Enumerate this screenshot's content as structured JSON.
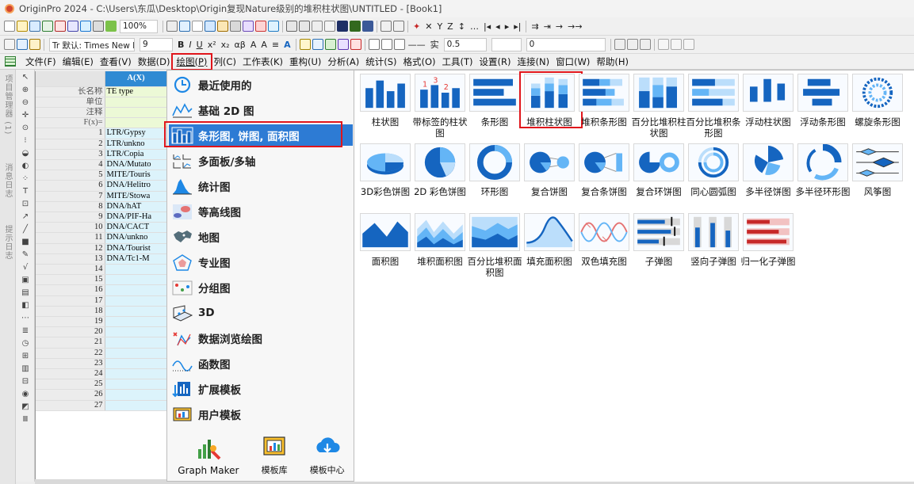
{
  "window": {
    "title": "OriginPro 2024 - C:\\Users\\东瓜\\Desktop\\Origin复现Nature级别的堆积柱状图\\UNTITLED - [Book1]"
  },
  "toolbar1": {
    "zoom": "100%"
  },
  "toolbar2": {
    "font_name": "Tr 默认: Times New R",
    "font_size": "9",
    "line_style": "实",
    "line_width": "0.5",
    "pattern_value": "0"
  },
  "menubar": {
    "items": [
      "文件(F)",
      "编辑(E)",
      "查看(V)",
      "数据(D)",
      "绘图(P)",
      "列(C)",
      "工作表(K)",
      "重构(U)",
      "分析(A)",
      "统计(S)",
      "格式(O)",
      "工具(T)",
      "设置(R)",
      "连接(N)",
      "窗口(W)",
      "帮助(H)"
    ],
    "active": "绘图(P)"
  },
  "sidebar": {
    "tabs": [
      "项目管理器 (1)",
      "消息日志",
      "提示日志"
    ]
  },
  "sheet": {
    "column_header": "A(X)",
    "meta_rows": [
      {
        "label": "长名称",
        "value": "TE type"
      },
      {
        "label": "单位",
        "value": ""
      },
      {
        "label": "注释",
        "value": ""
      },
      {
        "label": "F(x)=",
        "value": ""
      }
    ],
    "rows": [
      {
        "n": "1",
        "v": "LTR/Gypsy"
      },
      {
        "n": "2",
        "v": "LTR/unkno"
      },
      {
        "n": "3",
        "v": "LTR/Copia"
      },
      {
        "n": "4",
        "v": "DNA/Mutato"
      },
      {
        "n": "5",
        "v": "MITE/Touris"
      },
      {
        "n": "6",
        "v": "DNA/Helitro"
      },
      {
        "n": "7",
        "v": "MITE/Stowa"
      },
      {
        "n": "8",
        "v": "DNA/hAT"
      },
      {
        "n": "9",
        "v": "DNA/PIF-Ha"
      },
      {
        "n": "10",
        "v": "DNA/CACT"
      },
      {
        "n": "11",
        "v": "DNA/unkno"
      },
      {
        "n": "12",
        "v": "DNA/Tourist"
      },
      {
        "n": "13",
        "v": "DNA/Tc1-M"
      },
      {
        "n": "14",
        "v": ""
      },
      {
        "n": "15",
        "v": ""
      },
      {
        "n": "16",
        "v": ""
      },
      {
        "n": "17",
        "v": ""
      },
      {
        "n": "18",
        "v": ""
      },
      {
        "n": "19",
        "v": ""
      },
      {
        "n": "20",
        "v": ""
      },
      {
        "n": "21",
        "v": ""
      },
      {
        "n": "22",
        "v": ""
      },
      {
        "n": "23",
        "v": ""
      },
      {
        "n": "24",
        "v": ""
      },
      {
        "n": "25",
        "v": ""
      },
      {
        "n": "26",
        "v": ""
      },
      {
        "n": "27",
        "v": ""
      }
    ]
  },
  "plot_menu": {
    "items": [
      {
        "label": "最近使用的",
        "icon": "clock-icon"
      },
      {
        "label": "基础 2D 图",
        "icon": "line-chart-icon"
      },
      {
        "label": "条形图, 饼图, 面积图",
        "icon": "bar-chart-icon",
        "selected": true
      },
      {
        "label": "多面板/多轴",
        "icon": "multi-panel-icon"
      },
      {
        "label": "统计图",
        "icon": "histogram-icon"
      },
      {
        "label": "等高线图",
        "icon": "contour-icon"
      },
      {
        "label": "地图",
        "icon": "map-icon"
      },
      {
        "label": "专业图",
        "icon": "polar-icon"
      },
      {
        "label": "分组图",
        "icon": "group-icon"
      },
      {
        "label": "3D",
        "icon": "3d-icon"
      },
      {
        "label": "数据浏览绘图",
        "icon": "data-explore-icon"
      },
      {
        "label": "函数图",
        "icon": "function-icon"
      },
      {
        "label": "扩展模板",
        "icon": "download-template-icon"
      },
      {
        "label": "用户模板",
        "icon": "user-template-icon"
      }
    ],
    "bottom": [
      {
        "label": "Graph Maker"
      },
      {
        "label": "模板库"
      },
      {
        "label": "模板中心"
      }
    ]
  },
  "gallery": {
    "items": [
      {
        "label": "柱状图",
        "icon": "column-chart-icon"
      },
      {
        "label": "带标签的柱状图",
        "icon": "labeled-column-icon"
      },
      {
        "label": "条形图",
        "icon": "bar-chart-icon"
      },
      {
        "label": "堆积柱状图",
        "icon": "stacked-column-icon",
        "selected": true
      },
      {
        "label": "堆积条形图",
        "icon": "stacked-bar-icon"
      },
      {
        "label": "百分比堆积柱状图",
        "icon": "percent-stacked-column-icon"
      },
      {
        "label": "百分比堆积条形图",
        "icon": "percent-stacked-bar-icon"
      },
      {
        "label": "浮动柱状图",
        "icon": "floating-column-icon"
      },
      {
        "label": "浮动条形图",
        "icon": "floating-bar-icon"
      },
      {
        "label": "螺旋条形图",
        "icon": "spiral-bar-icon"
      },
      {
        "label": "3D彩色饼图",
        "icon": "3d-pie-icon"
      },
      {
        "label": "2D 彩色饼图",
        "icon": "2d-pie-icon"
      },
      {
        "label": "环形图",
        "icon": "doughnut-icon"
      },
      {
        "label": "复合饼图",
        "icon": "pie-of-pie-icon"
      },
      {
        "label": "复合条饼图",
        "icon": "bar-of-pie-icon"
      },
      {
        "label": "复合环饼图",
        "icon": "ring-of-pie-icon"
      },
      {
        "label": "同心圆弧图",
        "icon": "concentric-arc-icon"
      },
      {
        "label": "多半径饼图",
        "icon": "multi-radius-pie-icon"
      },
      {
        "label": "多半径环形图",
        "icon": "multi-radius-ring-icon"
      },
      {
        "label": "风筝图",
        "icon": "kite-chart-icon"
      },
      {
        "label": "面积图",
        "icon": "area-chart-icon"
      },
      {
        "label": "堆积面积图",
        "icon": "stacked-area-icon"
      },
      {
        "label": "百分比堆积面积图",
        "icon": "percent-stacked-area-icon"
      },
      {
        "label": "填充面积图",
        "icon": "fill-area-icon"
      },
      {
        "label": "双色填充图",
        "icon": "two-color-fill-icon"
      },
      {
        "label": "子弹图",
        "icon": "bullet-chart-icon"
      },
      {
        "label": "竖向子弹图",
        "icon": "vertical-bullet-icon"
      },
      {
        "label": "归一化子弹图",
        "icon": "normalized-bullet-icon"
      }
    ]
  },
  "colors": {
    "accent": "#2d7bd4",
    "highlight": "#e0151b",
    "header_blue": "#2f8ad3"
  }
}
